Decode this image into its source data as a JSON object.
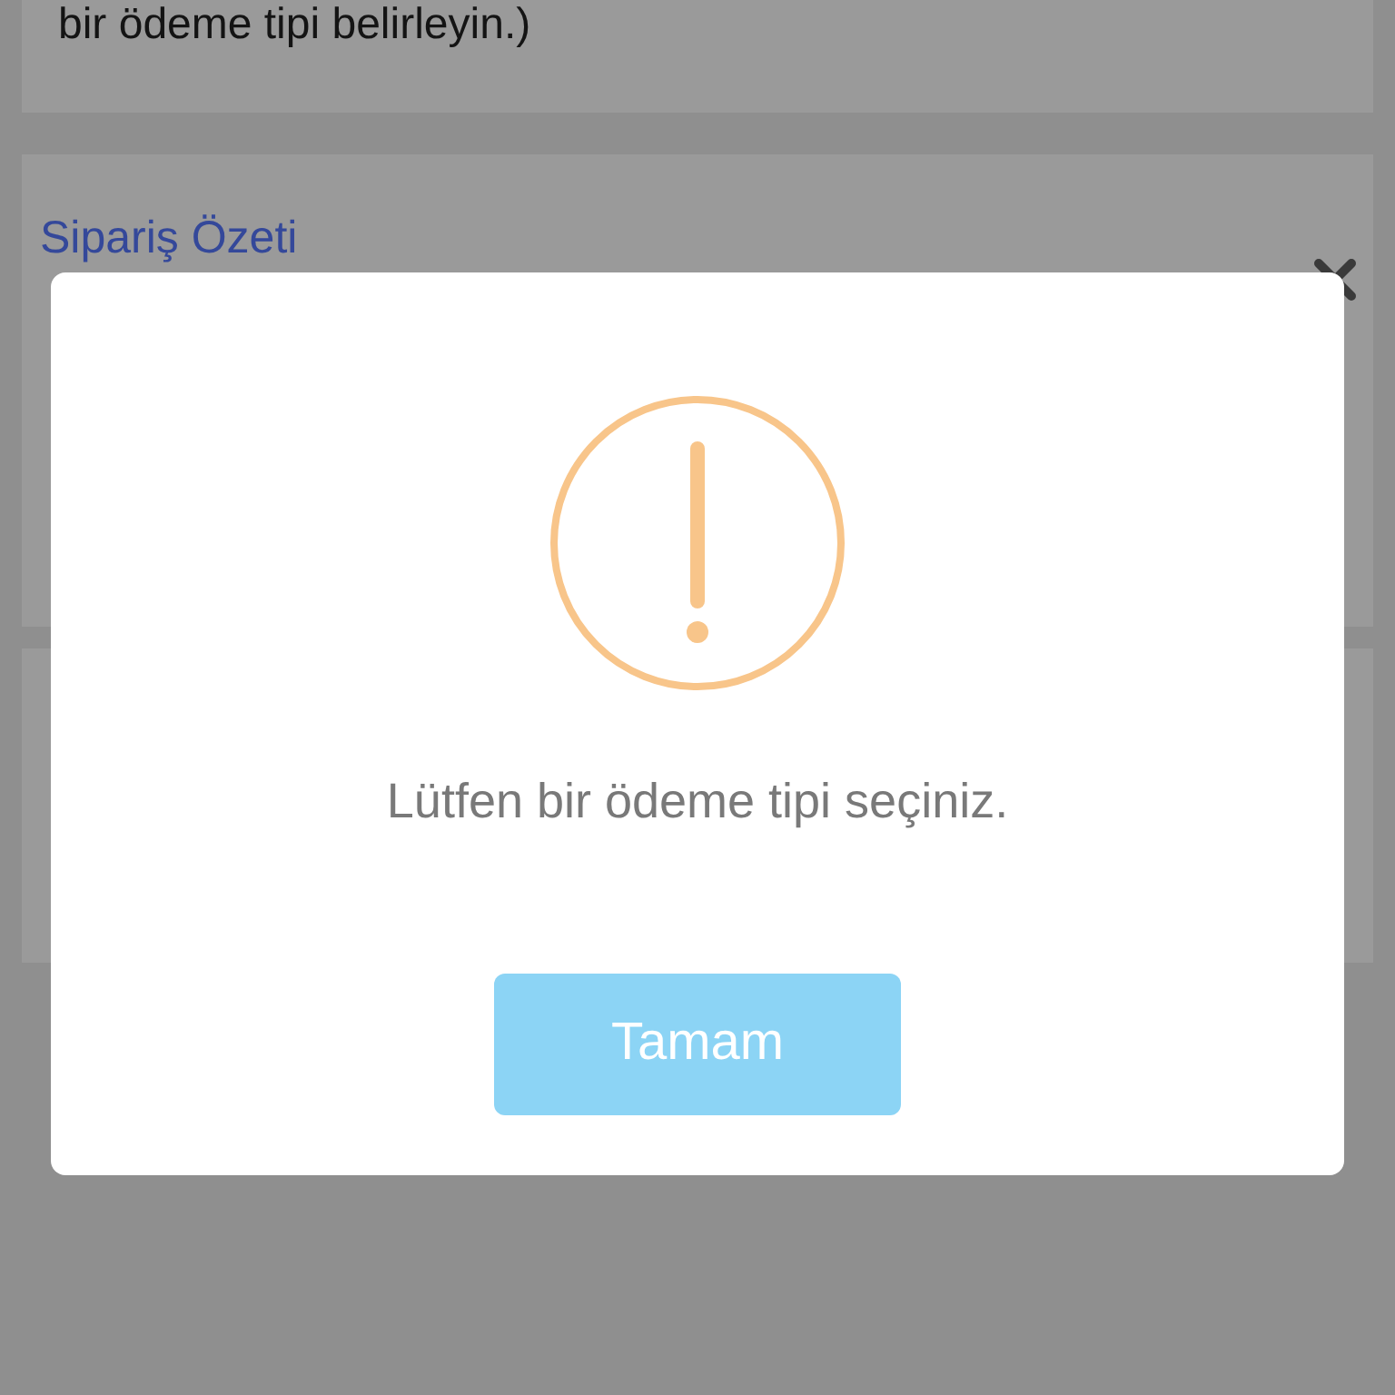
{
  "note_card": {
    "text": "bir ödeme tipi belirleyin.)"
  },
  "summary_card": {
    "title": "Sipariş Özeti"
  },
  "alert": {
    "kind": "warning",
    "message": "Lütfen bir ödeme tipi seçiniz.",
    "button": "Tamam"
  }
}
